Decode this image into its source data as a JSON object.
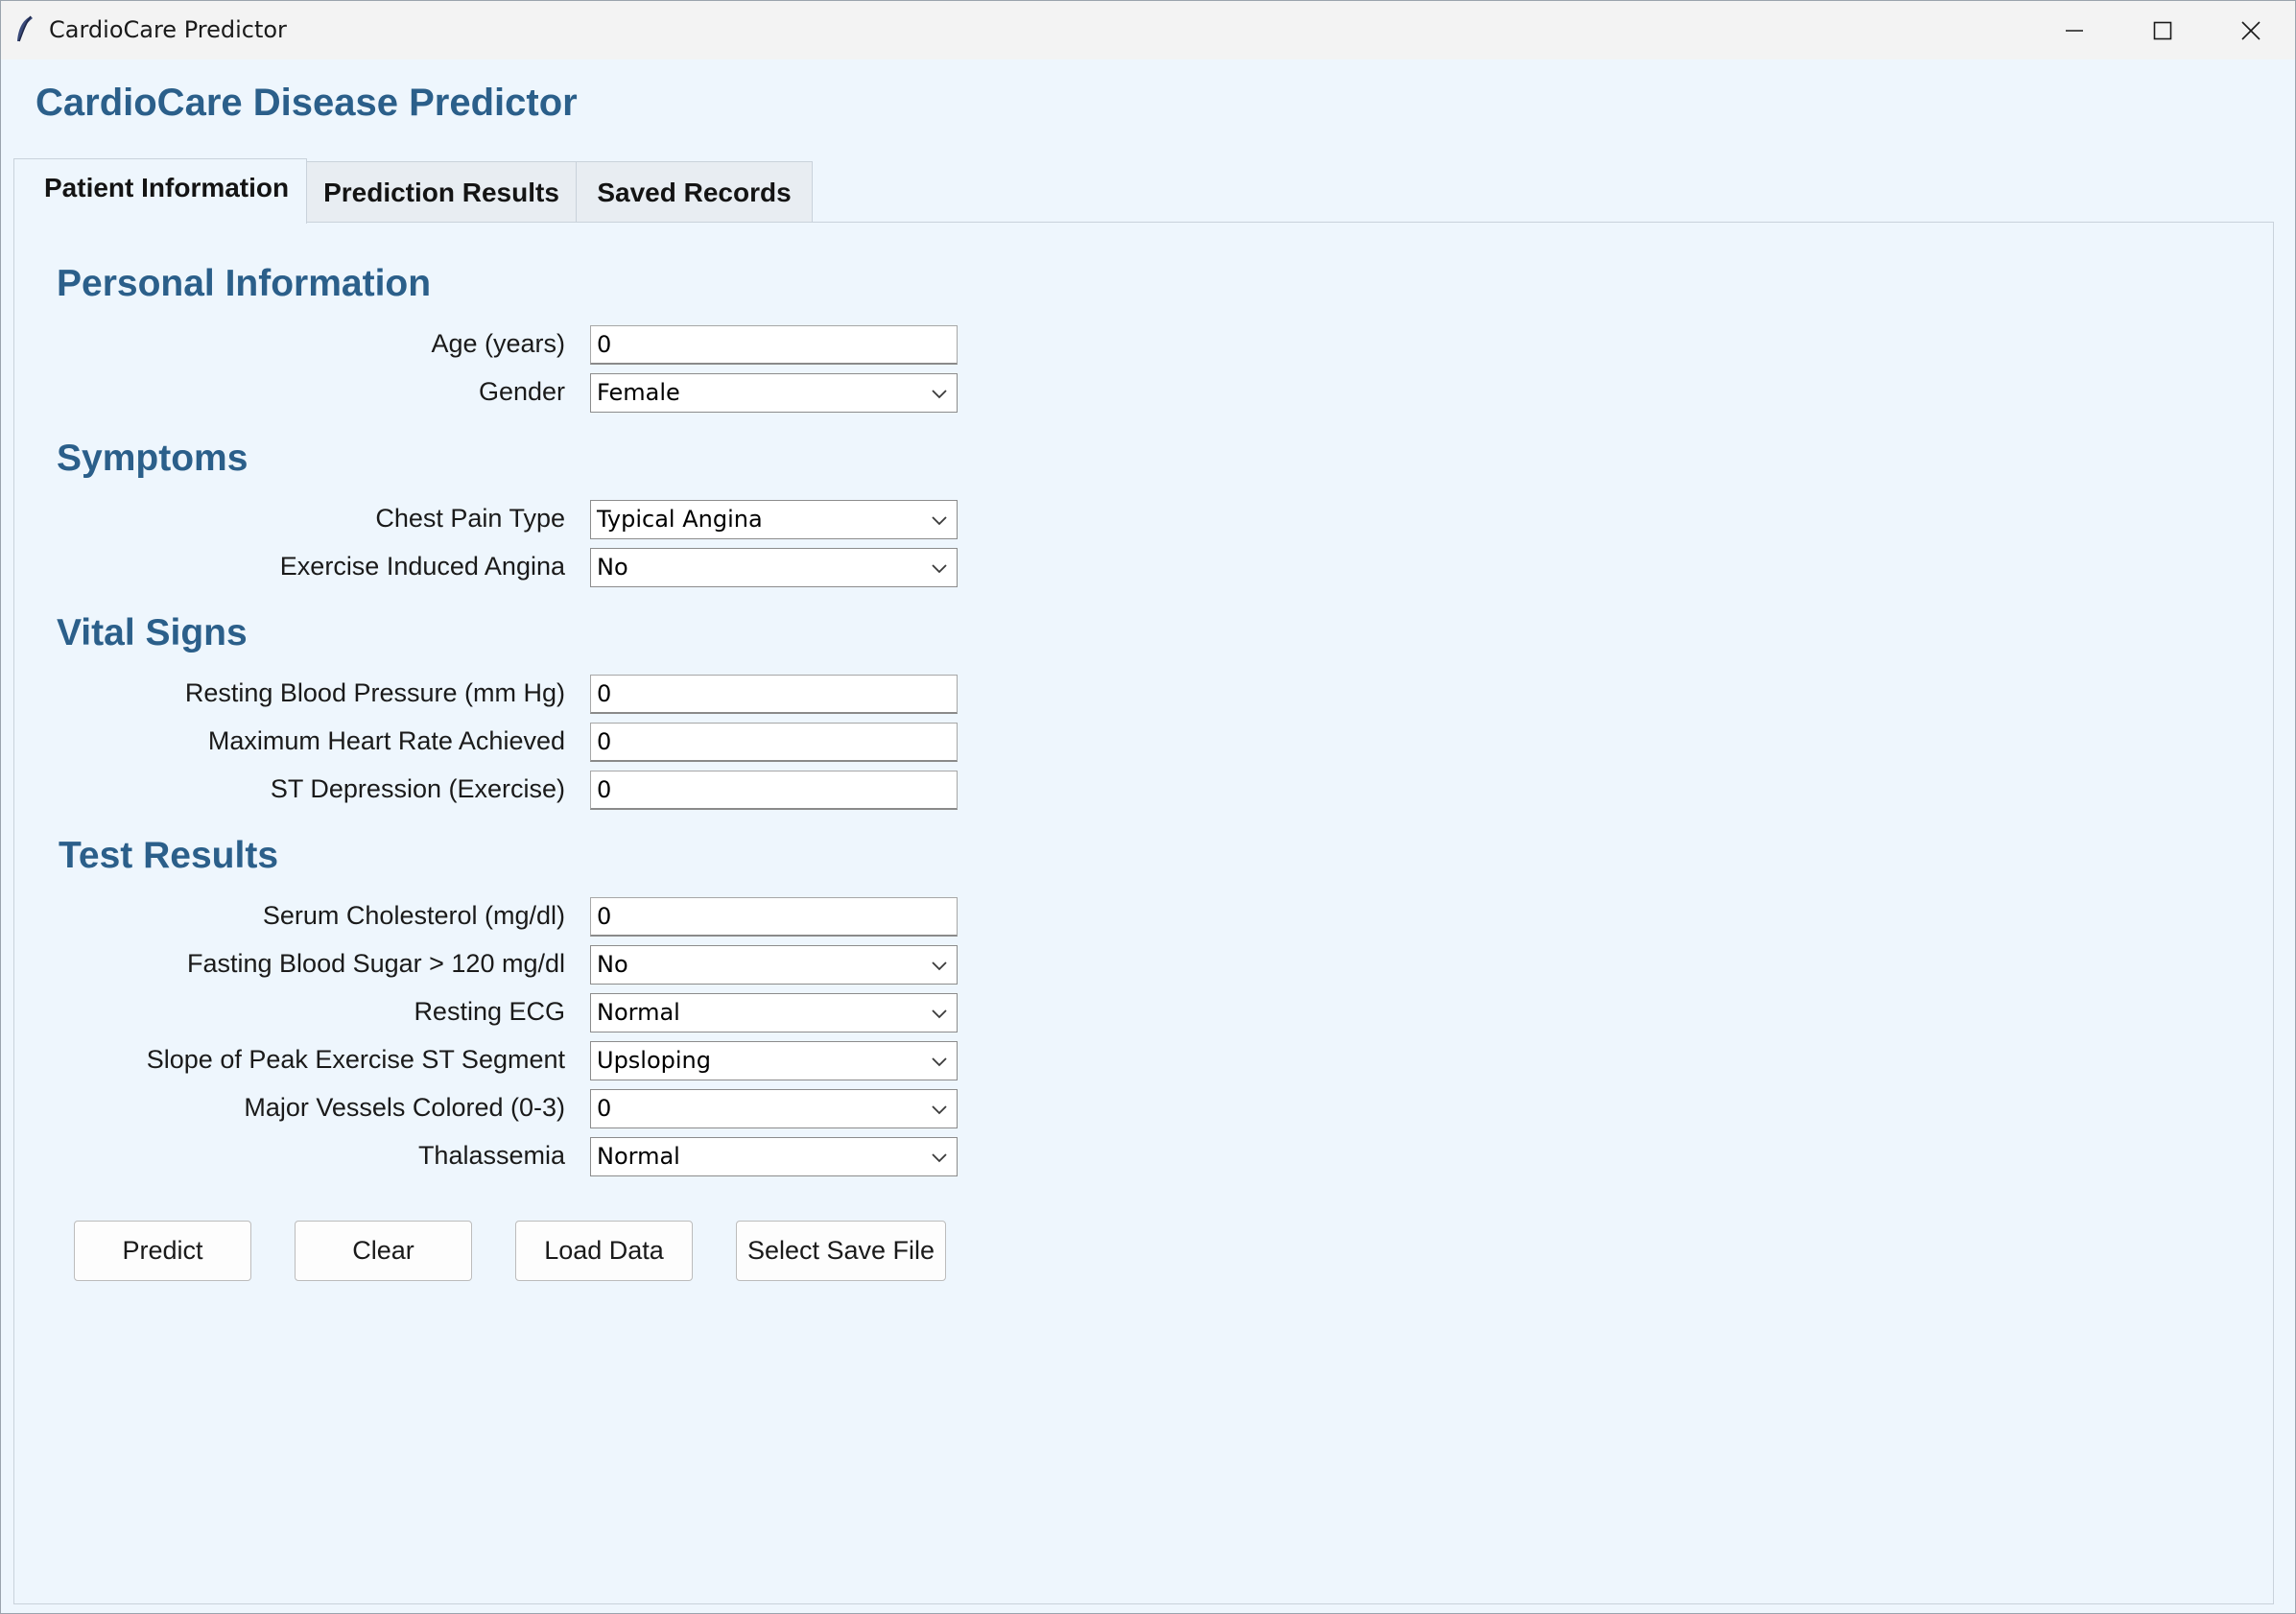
{
  "window": {
    "title": "CardioCare Predictor"
  },
  "header": {
    "title": "CardioCare Disease Predictor"
  },
  "tabs": [
    {
      "label": "Patient Information",
      "active": true
    },
    {
      "label": "Prediction Results",
      "active": false
    },
    {
      "label": "Saved Records",
      "active": false
    }
  ],
  "sections": {
    "personal": {
      "title": "Personal Information",
      "age_label": "Age (years)",
      "age_value": "0",
      "gender_label": "Gender",
      "gender_value": "Female"
    },
    "symptoms": {
      "title": "Symptoms",
      "chest_pain_label": "Chest Pain Type",
      "chest_pain_value": "Typical Angina",
      "angina_label": "Exercise Induced Angina",
      "angina_value": "No"
    },
    "vitals": {
      "title": "Vital Signs",
      "bp_label": "Resting Blood Pressure (mm Hg)",
      "bp_value": "0",
      "hr_label": "Maximum Heart Rate Achieved",
      "hr_value": "0",
      "st_label": "ST Depression (Exercise)",
      "st_value": "0"
    },
    "tests": {
      "title": "Test Results",
      "chol_label": "Serum Cholesterol (mg/dl)",
      "chol_value": "0",
      "fbs_label": "Fasting Blood Sugar > 120 mg/dl",
      "fbs_value": "No",
      "ecg_label": "Resting ECG",
      "ecg_value": "Normal",
      "slope_label": "Slope of Peak Exercise ST Segment",
      "slope_value": "Upsloping",
      "vessels_label": "Major Vessels Colored (0-3)",
      "vessels_value": "0",
      "thal_label": "Thalassemia",
      "thal_value": "Normal"
    }
  },
  "buttons": {
    "predict": "Predict",
    "clear": "Clear",
    "load": "Load Data",
    "select_save": "Select Save File"
  },
  "icons": {
    "app": "feather-icon",
    "minimize": "minimize-icon",
    "maximize": "maximize-icon",
    "close": "close-icon",
    "dropdown": "chevron-down-icon"
  },
  "colors": {
    "accent": "#2b5f8a",
    "background": "#eef6fd"
  }
}
